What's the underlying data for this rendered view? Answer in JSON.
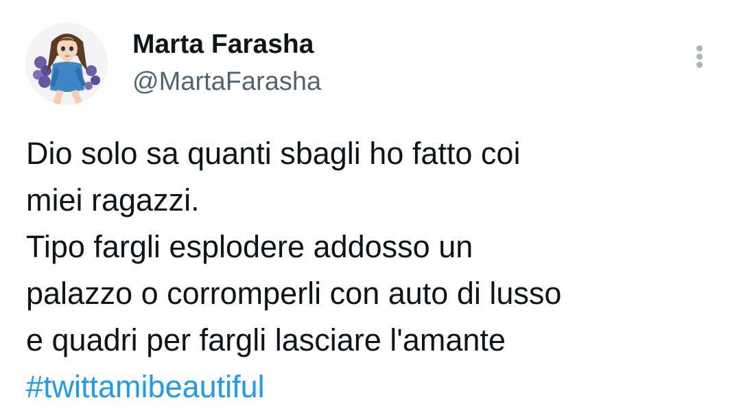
{
  "author": {
    "display_name": "Marta Farasha",
    "handle": "@MartaFarasha",
    "avatar_icon": "anime-girl-avatar"
  },
  "menu": {
    "icon": "more-vertical-icon"
  },
  "tweet": {
    "lines": [
      "Dio solo sa quanti sbagli ho fatto coi",
      "miei ragazzi.",
      "Tipo fargli esplodere addosso un",
      "palazzo o corromperli con auto di lusso",
      "e quadri per fargli lasciare l'amante"
    ],
    "hashtag": "#twittamibeautiful"
  },
  "colors": {
    "text": "#0f1419",
    "secondary": "#536471",
    "link": "#1d9bf0",
    "menu_dots": "#a9b4bd"
  }
}
